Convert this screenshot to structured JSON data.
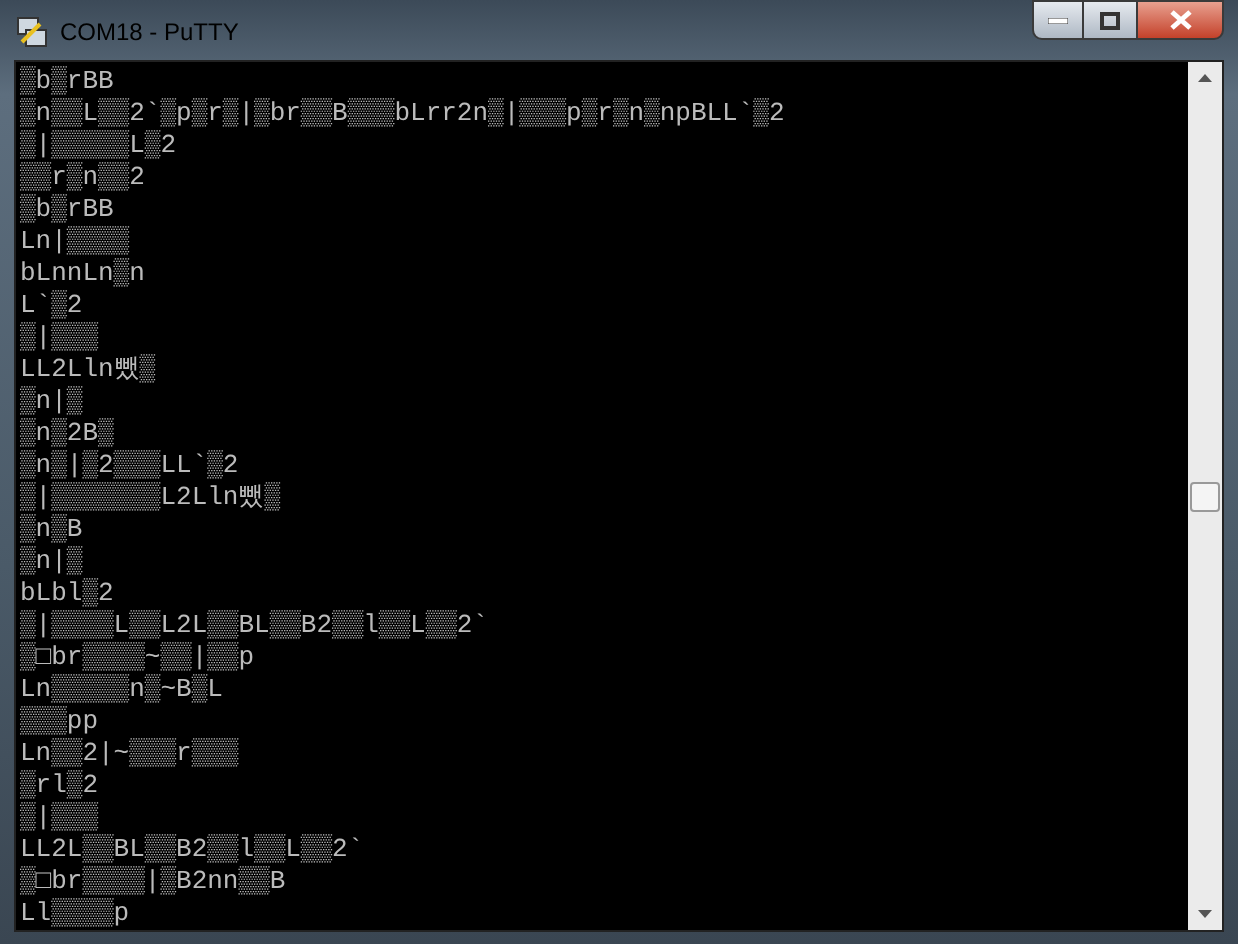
{
  "window": {
    "title": "COM18 - PuTTY"
  },
  "terminal": {
    "lines": [
      "▒b▒rBB",
      "▒n▒▒L▒▒2`▒p▒r▒|▒br▒▒B▒▒▒bLrr2n▒|▒▒▒p▒r▒n▒npBLL`▒2",
      "▒|▒▒▒▒▒L▒2",
      "▒▒r▒n▒▒2",
      "▒b▒rBB",
      "Ln|▒▒▒▒",
      "bLnnLn▒n",
      "L`▒2",
      "▒|▒▒▒",
      "LL2Lln뺐▒",
      "▒n|▒",
      "▒n▒2B▒",
      "▒n▒|▒2▒▒▒LL`▒2",
      "▒|▒▒▒▒▒▒▒L2Lln뺐▒",
      "▒n▒B",
      "▒n|▒",
      "bLbl▒2",
      "▒|▒▒▒▒L▒▒L2L▒▒BL▒▒B2▒▒l▒▒L▒▒2`",
      "▒□br▒▒▒▒~▒▒|▒▒p",
      "Ln▒▒▒▒▒n▒~B▒L",
      "▒▒▒pp",
      "Ln▒▒2|~▒▒▒r▒▒▒",
      "▒rl▒2",
      "▒|▒▒▒",
      "LL2L▒▒BL▒▒B2▒▒l▒▒L▒▒2`",
      "▒□br▒▒▒▒|▒B2nn▒▒B",
      "Ll▒▒▒▒p"
    ]
  }
}
